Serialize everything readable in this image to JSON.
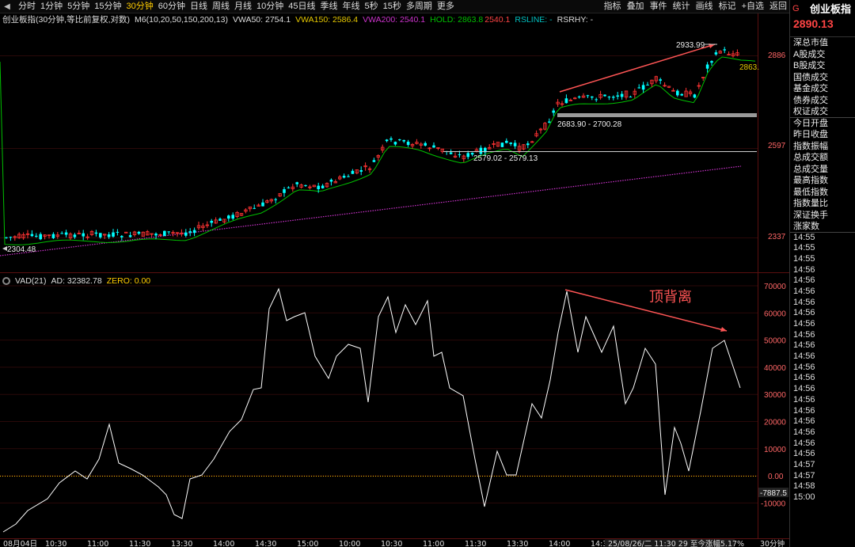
{
  "toolbar": {
    "periods": [
      "分时",
      "1分钟",
      "5分钟",
      "15分钟",
      "30分钟",
      "60分钟",
      "日线",
      "周线",
      "月线",
      "10分钟",
      "45日线",
      "季线",
      "年线",
      "5秒",
      "15秒",
      "多周期",
      "更多"
    ],
    "active_period": "30分钟",
    "right_items": [
      "指标",
      "叠加",
      "事件",
      "统计",
      "画线",
      "标记",
      "+自选",
      "返回"
    ]
  },
  "main_legend": {
    "title": "创业板指(30分钟,等比前复权,对数)",
    "ma": "M6(10,20,50,150,200,13)",
    "vwa50": "VWA50: 2754.1",
    "vwa150": "VWA150: 2586.4",
    "vwa200": "VWA200: 2540.1",
    "hold": "HOLD: 2863.8",
    "hold2": "2540.1",
    "rsline": "RSLINE: -",
    "rsrhy": "RSRHY: -"
  },
  "vad_legend": {
    "name": "VAD(21)",
    "ad": "AD: 32382.78",
    "zero": "ZERO: 0.00"
  },
  "annotations": {
    "high": "2933.99",
    "low": "2304.48",
    "range1": "2683.90 - 2700.28",
    "range2": "2579.02 - 2579.13",
    "current": "2863.",
    "divergence": "顶背离",
    "vad_current": "-7887.5",
    "bottom_info": "25/08/26/二 11:30 29 至今涨幅5.17%",
    "period_tag": "30分钟"
  },
  "price_axis": [
    "2886",
    "2597",
    "2337"
  ],
  "vad_axis": [
    "70000",
    "60000",
    "50000",
    "40000",
    "30000",
    "20000",
    "10000",
    "0.00",
    "-10000"
  ],
  "time_axis": [
    "08月04日",
    "10:30",
    "11:00",
    "11:30",
    "13:30",
    "14:00",
    "14:30",
    "15:00",
    "10:00",
    "10:30",
    "11:00",
    "11:30",
    "13:30",
    "14:00",
    "14:30"
  ],
  "panel": {
    "flag": "G",
    "name": "创业板指",
    "price": "2890.13",
    "rows": [
      "深总市值",
      "A股成交",
      "B股成交",
      "国债成交",
      "基金成交",
      "债券成交",
      "权证成交",
      "今日开盘",
      "昨日收盘",
      "指数振幅",
      "总成交额",
      "总成交量",
      "最高指数",
      "最低指数",
      "指数量比",
      "深证换手",
      "涨家数"
    ],
    "times": [
      "14:55",
      "14:55",
      "14:55",
      "14:56",
      "14:56",
      "14:56",
      "14:56",
      "14:56",
      "14:56",
      "14:56",
      "14:56",
      "14:56",
      "14:56",
      "14:56",
      "14:56",
      "14:56",
      "14:56",
      "14:56",
      "14:56",
      "14:56",
      "14:56",
      "14:57",
      "14:57",
      "14:58",
      "15:00"
    ]
  },
  "colors": {
    "up": "#ff3333",
    "down": "#00ffff",
    "hold": "#00c000",
    "vwa200": "#cc33cc",
    "vad": "#ffffff",
    "zero": "#ffcc00",
    "trend": "#ff5555"
  }
}
